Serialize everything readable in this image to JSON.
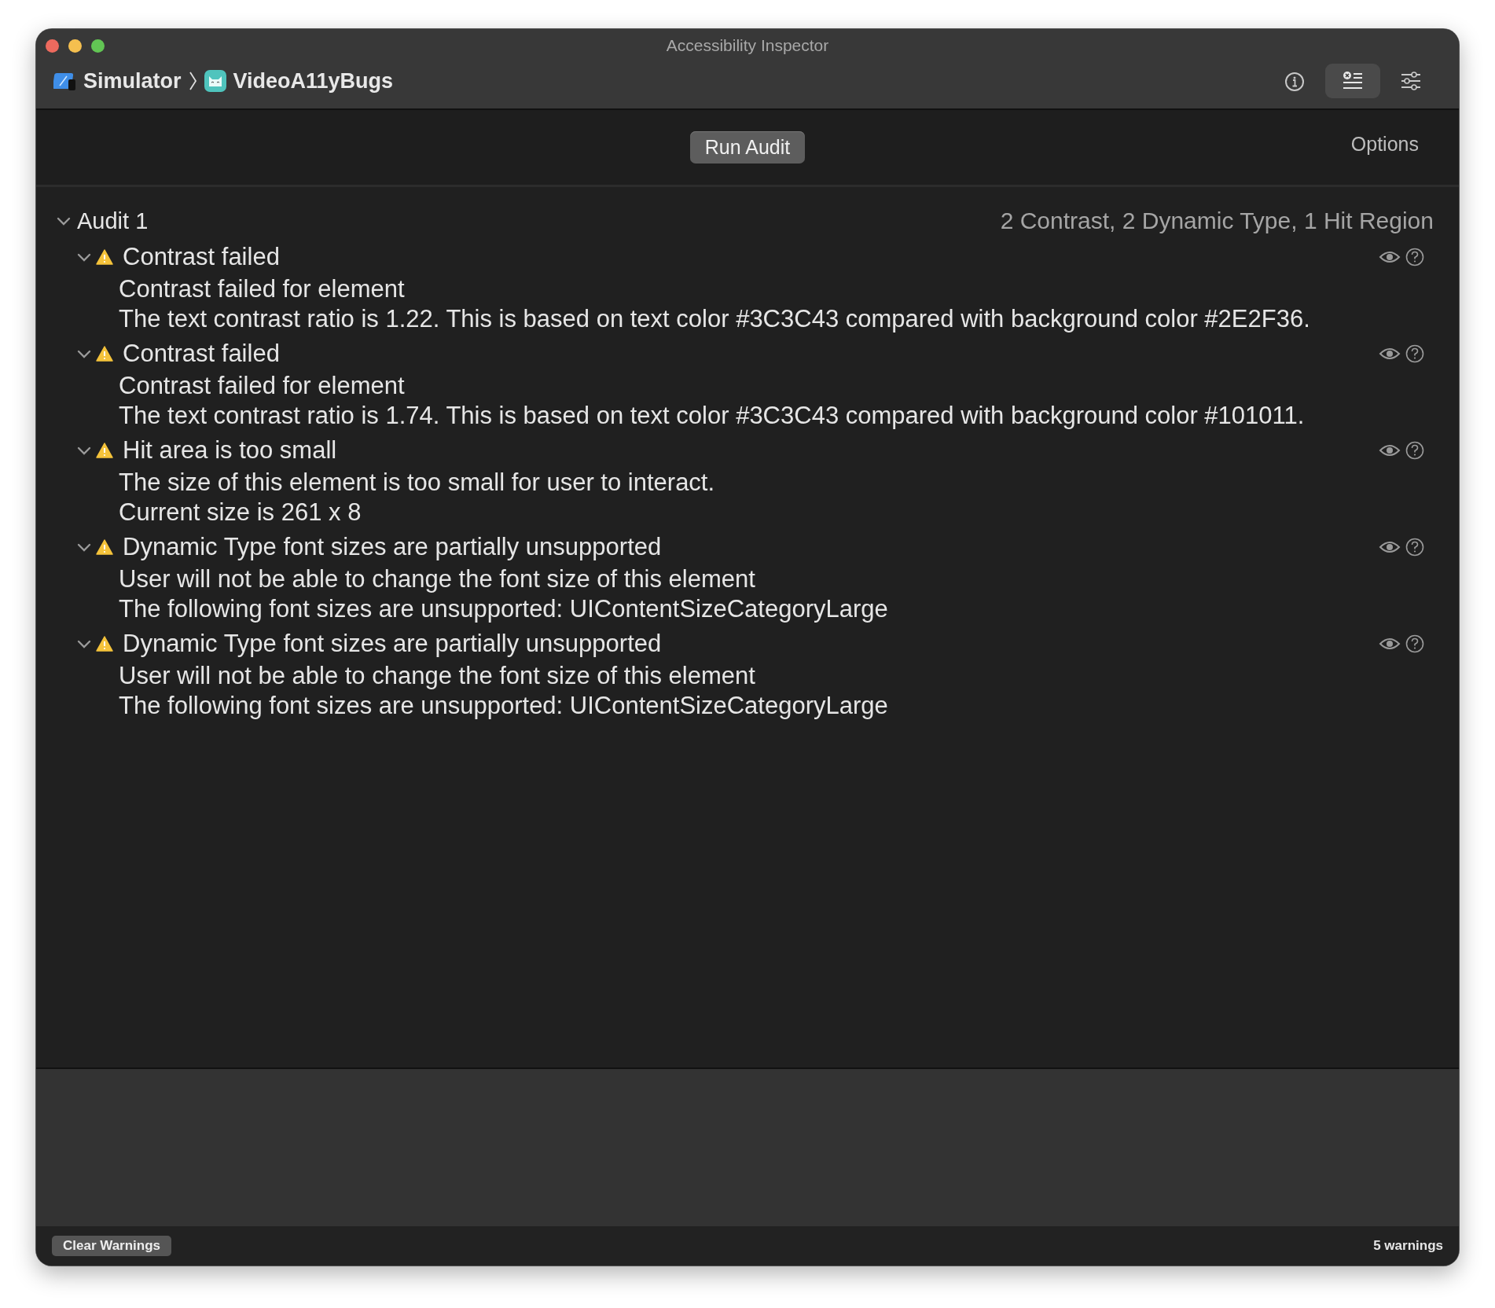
{
  "window": {
    "title": "Accessibility Inspector"
  },
  "breadcrumb": [
    {
      "label": "Simulator",
      "kind": "simulator"
    },
    {
      "label": "VideoA11yBugs",
      "kind": "app"
    }
  ],
  "toolbar_buttons": [
    {
      "kind": "info",
      "selected": false
    },
    {
      "kind": "audit",
      "selected": true
    },
    {
      "kind": "settings",
      "selected": false
    }
  ],
  "run_audit_button": "Run Audit",
  "options_button": "Options",
  "audit": {
    "title": "Audit 1",
    "expanded": true,
    "summary": "2 Contrast, 2 Dynamic Type, 1 Hit Region",
    "issues": [
      {
        "title": "Contrast failed",
        "expanded": true,
        "lines": [
          "Contrast failed for element",
          "The text contrast ratio is 1.22. This is based on text color #3C3C43 compared with background color #2E2F36."
        ]
      },
      {
        "title": "Contrast failed",
        "expanded": true,
        "lines": [
          "Contrast failed for element",
          "The text contrast ratio is 1.74. This is based on text color #3C3C43 compared with background color #101011."
        ]
      },
      {
        "title": "Hit area is too small",
        "expanded": true,
        "lines": [
          "The size of this element is too small for user to interact.",
          "Current size is 261 x 8"
        ]
      },
      {
        "title": "Dynamic Type font sizes are partially unsupported",
        "expanded": true,
        "lines": [
          "User will not be able to change the font size of this element",
          "The following font sizes are unsupported: UIContentSizeCategoryLarge"
        ]
      },
      {
        "title": "Dynamic Type font sizes are partially unsupported",
        "expanded": true,
        "lines": [
          "User will not be able to change the font size of this element",
          "The following font sizes are unsupported: UIContentSizeCategoryLarge"
        ]
      }
    ]
  },
  "footer": {
    "clear_button": "Clear Warnings",
    "count": "5 warnings"
  }
}
